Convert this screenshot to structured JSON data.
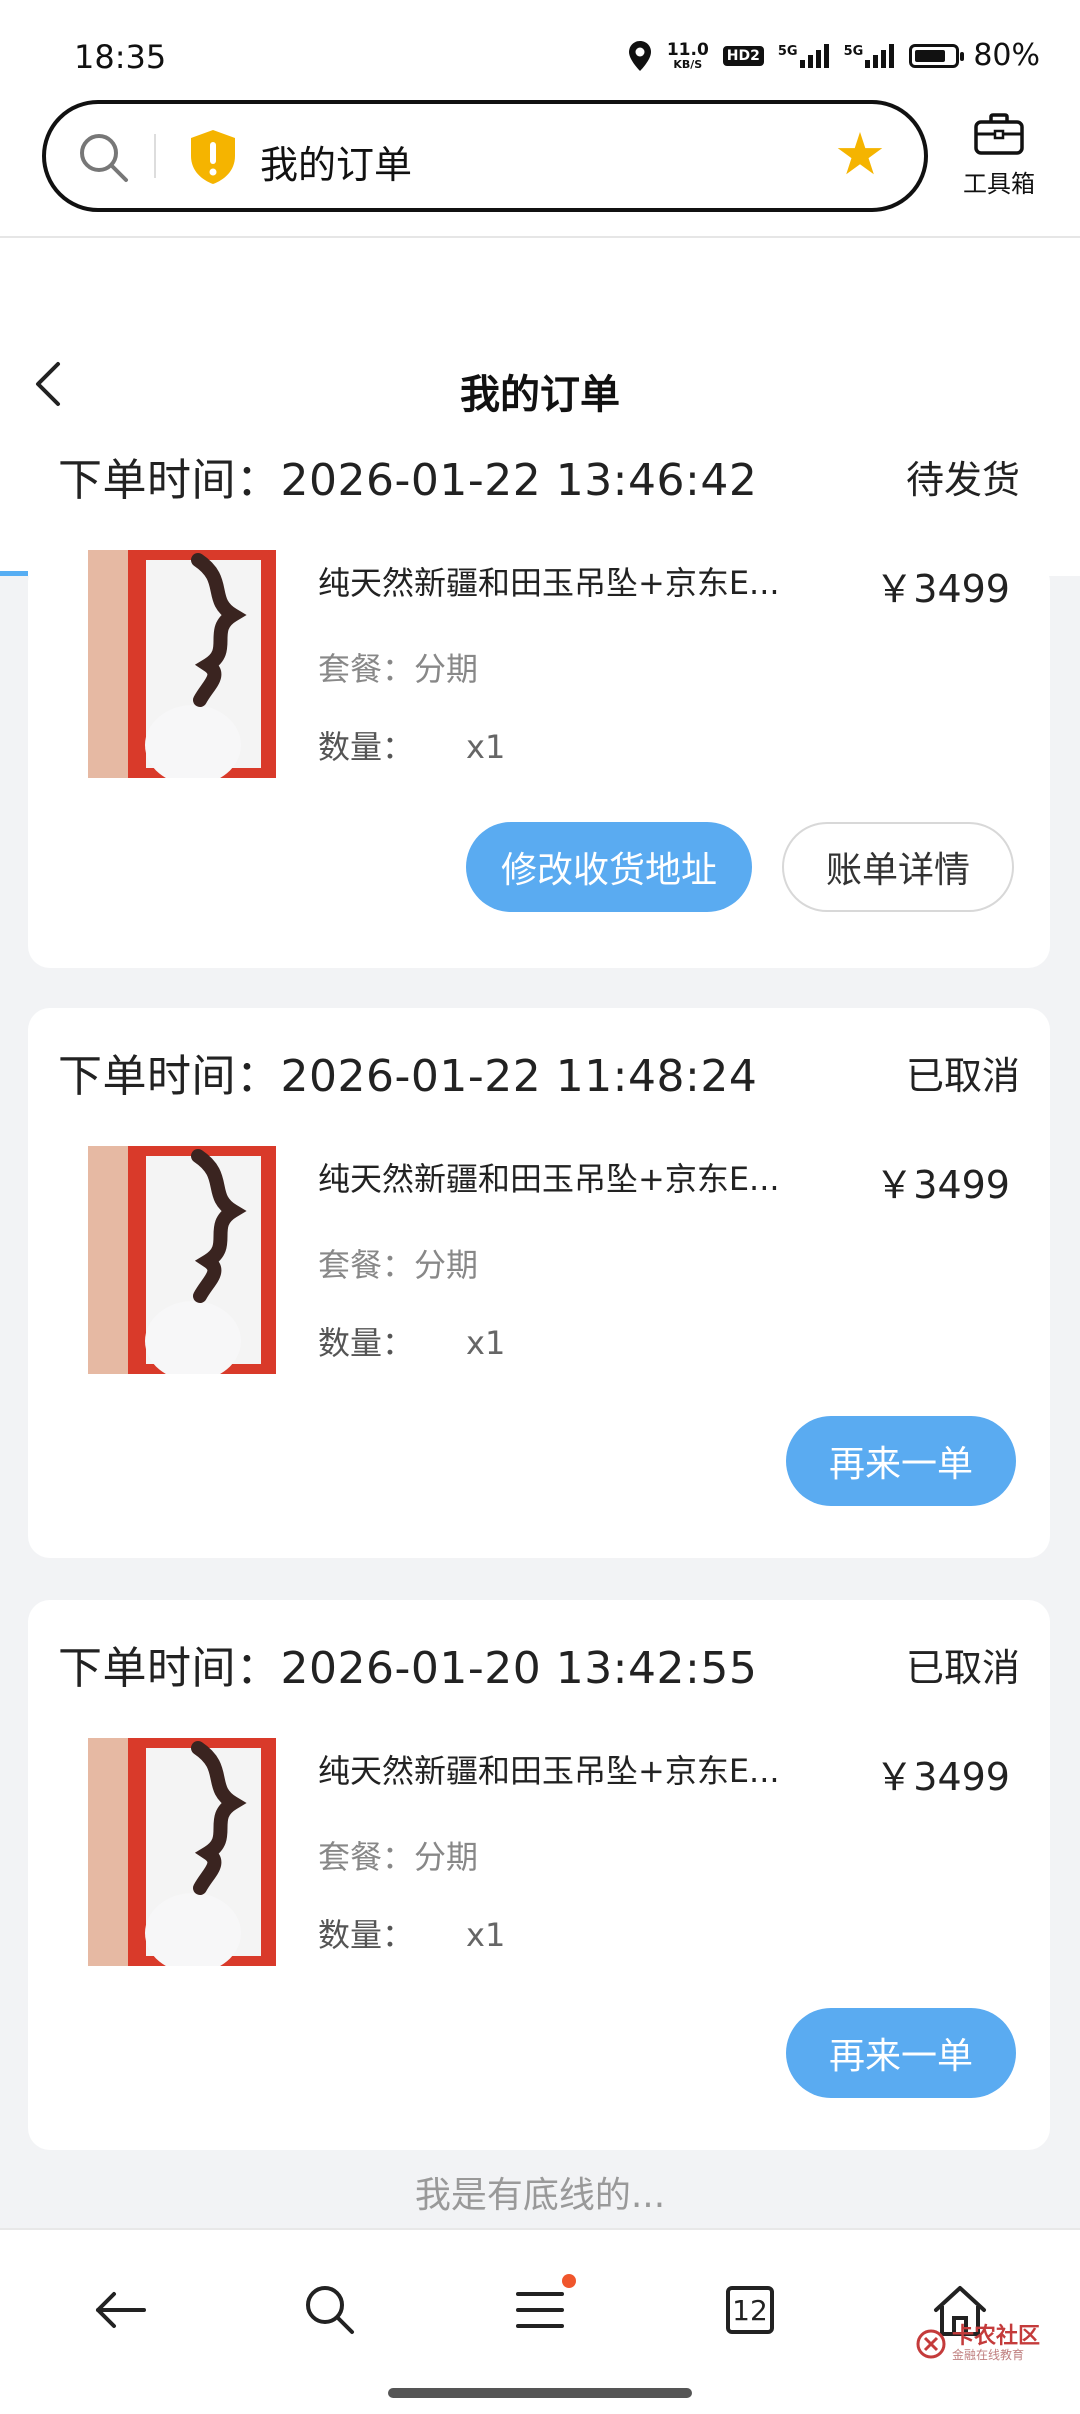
{
  "status_bar": {
    "time": "18:35",
    "net_speed": "11.0",
    "net_unit": "KB/S",
    "hd_label": "HD2",
    "sig1_label": "5G",
    "sig2_label": "5G",
    "battery_percent": 80,
    "battery_text": "80%"
  },
  "browser": {
    "address_text": "我的订单",
    "toolbox_label": "工具箱"
  },
  "page": {
    "title": "我的订单"
  },
  "orders": [
    {
      "time_label": "下单时间：",
      "time": "2026-01-22 13:46:42",
      "status": "待发货",
      "product_name": "纯天然新疆和田玉吊坠+京东E...",
      "price": "￥3499",
      "plan_label": "套餐：",
      "plan": "分期",
      "qty_label": "数量：",
      "qty": "x1",
      "buttons": [
        "修改收货地址",
        "账单详情"
      ]
    },
    {
      "time_label": "下单时间：",
      "time": "2026-01-22 11:48:24",
      "status": "已取消",
      "product_name": "纯天然新疆和田玉吊坠+京东E...",
      "price": "￥3499",
      "plan_label": "套餐：",
      "plan": "分期",
      "qty_label": "数量：",
      "qty": "x1",
      "buttons": [
        "再来一单"
      ]
    },
    {
      "time_label": "下单时间：",
      "time": "2026-01-20 13:42:55",
      "status": "已取消",
      "product_name": "纯天然新疆和田玉吊坠+京东E...",
      "price": "￥3499",
      "plan_label": "套餐：",
      "plan": "分期",
      "qty_label": "数量：",
      "qty": "x1",
      "buttons": [
        "再来一单"
      ]
    }
  ],
  "footer": {
    "end_text": "我是有底线的..."
  },
  "bottom_nav": {
    "items": [
      "back-icon",
      "search-icon",
      "menu-icon",
      "tabs-icon",
      "home-icon"
    ],
    "tabs_count": "12",
    "watermark_main": "卡农社区",
    "watermark_sub": "金融在线教育"
  },
  "colors": {
    "accent": "#5aabf1",
    "star": "#f5b400",
    "shield": "#f5b400",
    "badge": "#f0562c"
  }
}
